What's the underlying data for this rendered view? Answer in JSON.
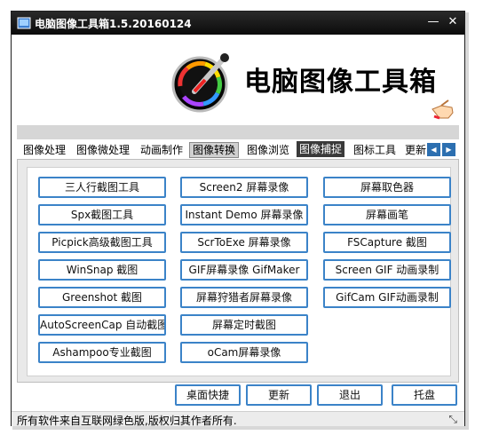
{
  "window": {
    "title": "电脑图像工具箱1.5.20160124",
    "minimize_glyph": "—",
    "close_glyph": "✕"
  },
  "banner": {
    "title": "电脑图像工具箱"
  },
  "tabs": [
    {
      "label": "图像处理"
    },
    {
      "label": "图像微处理"
    },
    {
      "label": "动画制作"
    },
    {
      "label": "图像转换"
    },
    {
      "label": "图像浏览"
    },
    {
      "label": "图像捕捉"
    },
    {
      "label": "图标工具"
    },
    {
      "label": "更新"
    }
  ],
  "tool_buttons": {
    "col1": [
      "三人行截图工具",
      "Spx截图工具",
      "Picpick高级截图工具",
      "WinSnap 截图",
      "Greenshot 截图",
      "AutoScreenCap 自动截图",
      "Ashampoo专业截图"
    ],
    "col2": [
      "Screen2 屏幕录像",
      "Instant Demo 屏幕录像",
      "ScrToExe 屏幕录像",
      "GIF屏幕录像 GifMaker",
      "屏幕狩猎者屏幕录像",
      "屏幕定时截图",
      "oCam屏幕录像"
    ],
    "col3": [
      "屏幕取色器",
      "屏幕画笔",
      "FSCapture 截图",
      "Screen GIF 动画录制",
      "GifCam GIF动画录制"
    ]
  },
  "actions": {
    "shortcut": "桌面快捷",
    "update": "更新",
    "exit": "退出",
    "tray": "托盘"
  },
  "status": {
    "text": "所有软件来自互联网绿色版,版权归其作者所有."
  }
}
